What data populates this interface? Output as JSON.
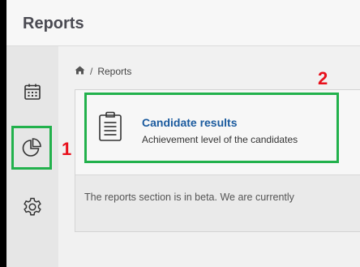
{
  "app": {
    "title": "Reports"
  },
  "breadcrumb": {
    "home_icon": "home-icon",
    "separator": "/",
    "current": "Reports"
  },
  "sidebar": {
    "items": [
      {
        "name": "calendar",
        "icon": "calendar-icon"
      },
      {
        "name": "reports",
        "icon": "pie-chart-icon",
        "active": true
      },
      {
        "name": "settings",
        "icon": "gear-icon"
      }
    ]
  },
  "card": {
    "icon": "clipboard-icon",
    "title": "Candidate results",
    "subtitle": "Achievement level of the candidates"
  },
  "notice": {
    "text": "The reports section is in beta. We are currently"
  },
  "annotations": {
    "marker_1": "1",
    "marker_2": "2",
    "highlight_color": "#22b14c",
    "number_color": "#e8101c"
  }
}
